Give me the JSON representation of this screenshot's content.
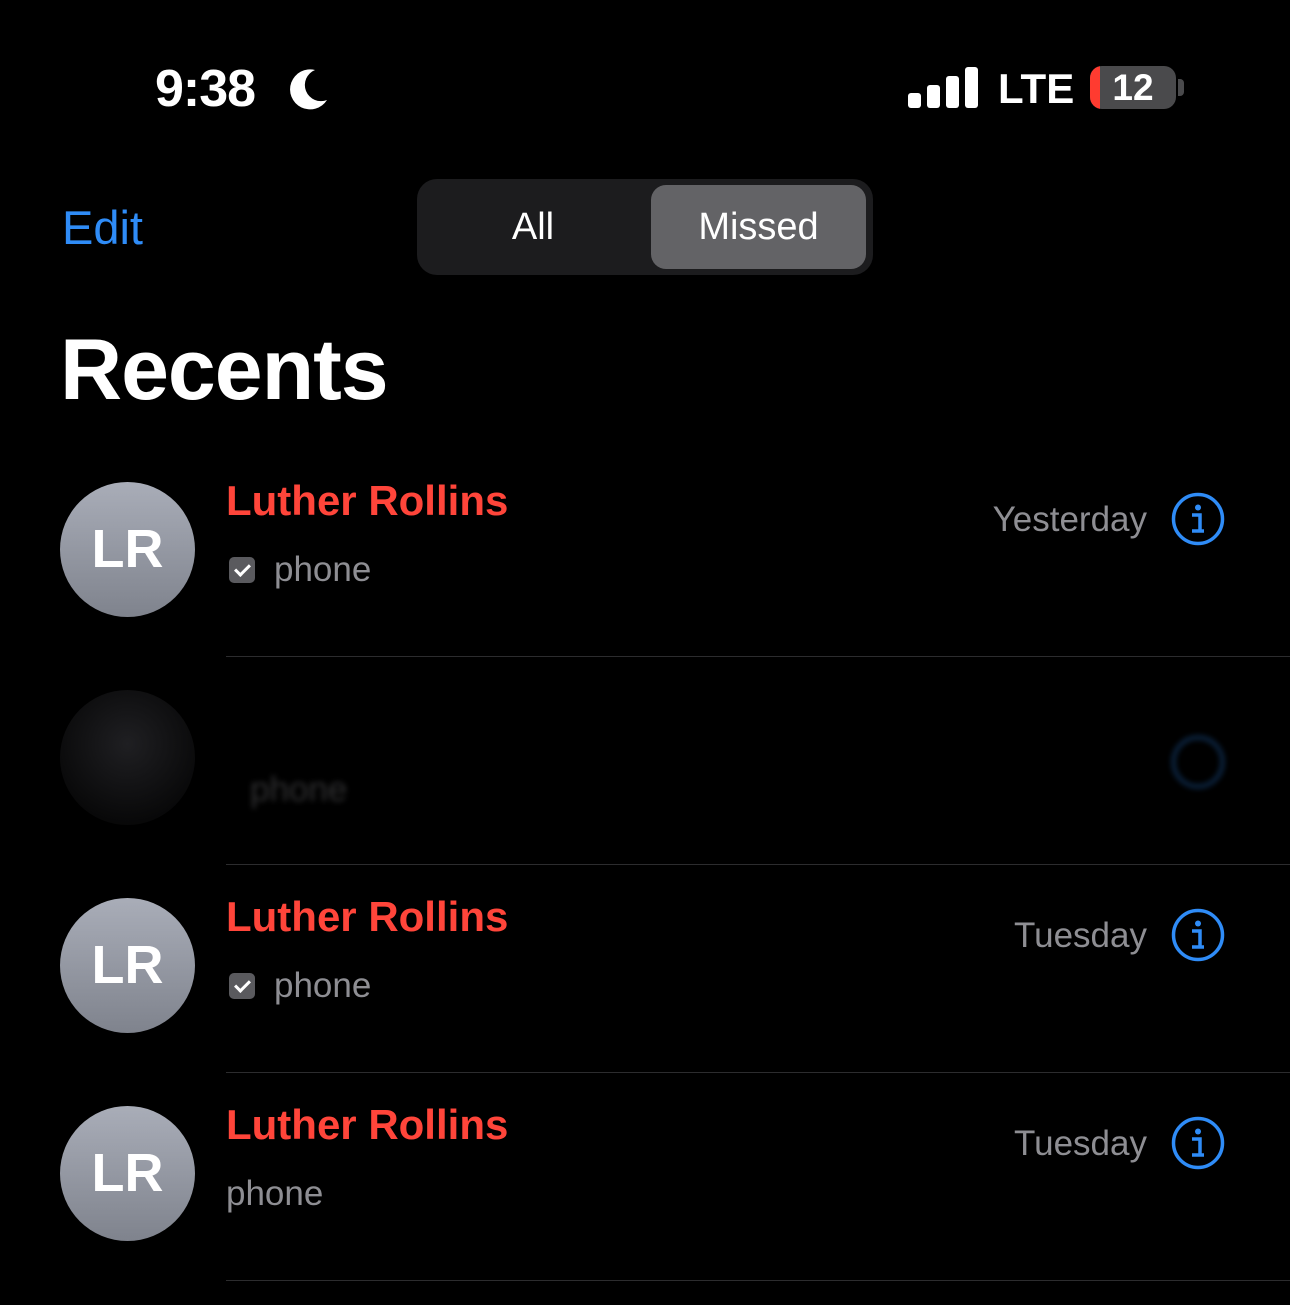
{
  "status_bar": {
    "time": "9:38",
    "moon_icon": "moon-icon",
    "network": "LTE",
    "battery": "12",
    "battery_level_percent": 12
  },
  "nav": {
    "edit_label": "Edit",
    "segments": [
      {
        "label": "All",
        "selected": false
      },
      {
        "label": "Missed",
        "selected": true
      }
    ]
  },
  "title": "Recents",
  "colors": {
    "missed_name": "#ff453a",
    "accent": "#2f8cf7",
    "secondary_text": "#8e8e93",
    "selected_segment": "#636366"
  },
  "calls": [
    {
      "initials": "LR",
      "name": "Luther Rollins",
      "type": "phone",
      "checked": true,
      "date": "Yesterday"
    },
    {
      "initials": "",
      "name": "",
      "type": "phone",
      "checked": false,
      "date": ""
    },
    {
      "initials": "LR",
      "name": "Luther Rollins",
      "type": "phone",
      "checked": true,
      "date": "Tuesday"
    },
    {
      "initials": "LR",
      "name": "Luther Rollins",
      "type": "phone",
      "checked": false,
      "date": "Tuesday"
    }
  ]
}
